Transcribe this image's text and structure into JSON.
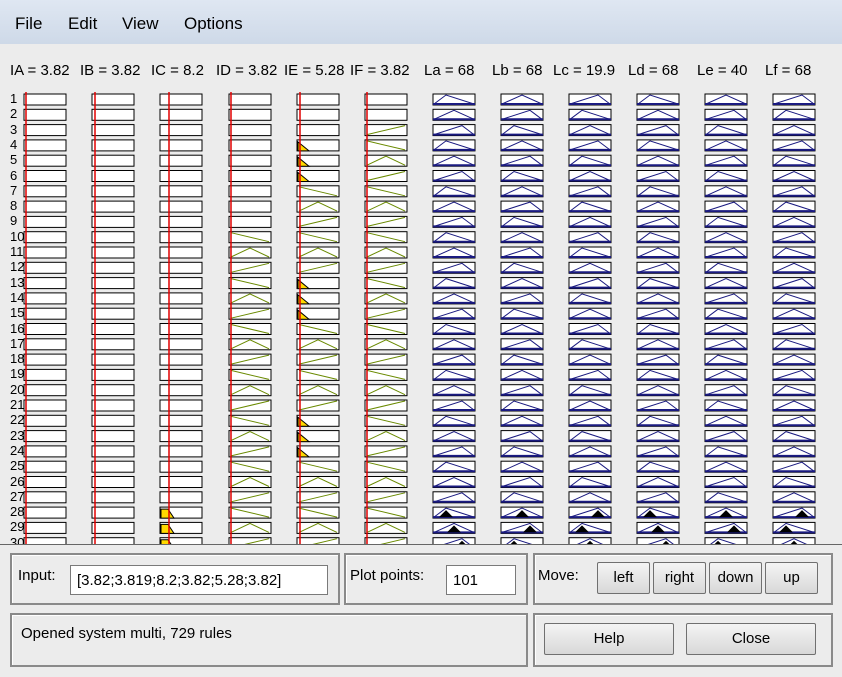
{
  "menu": [
    "File",
    "Edit",
    "View",
    "Options"
  ],
  "headers": [
    "IA = 3.82",
    "IB = 3.82",
    "IC = 8.2",
    "ID = 3.82",
    "IE = 5.28",
    "IF = 3.82",
    "La = 68",
    "Lb = 68",
    "Lc = 19.9",
    "Ld = 68",
    "Le = 40",
    "Lf = 68"
  ],
  "row_labels": [
    "1",
    "2",
    "3",
    "4",
    "5",
    "6",
    "7",
    "8",
    "9",
    "10",
    "11",
    "12",
    "13",
    "14",
    "15",
    "16",
    "17",
    "18",
    "19",
    "20",
    "21",
    "22",
    "23",
    "24",
    "25",
    "26",
    "27",
    "28",
    "29",
    "30"
  ],
  "colors": {
    "index_line": "#e00000",
    "mf_fill": "#ffd800",
    "output_line": "#1a1a80",
    "curve": "#6a8a00"
  },
  "input": {
    "label": "Input:",
    "value": "[3.82;3.819;8.2;3.82;5.28;3.82]"
  },
  "plot_points": {
    "label": "Plot points:",
    "value": "101"
  },
  "move": {
    "label": "Move:",
    "left": "left",
    "right": "right",
    "down": "down",
    "up": "up"
  },
  "status": "Opened system multi, 729 rules",
  "buttons": {
    "help": "Help",
    "close": "Close"
  }
}
